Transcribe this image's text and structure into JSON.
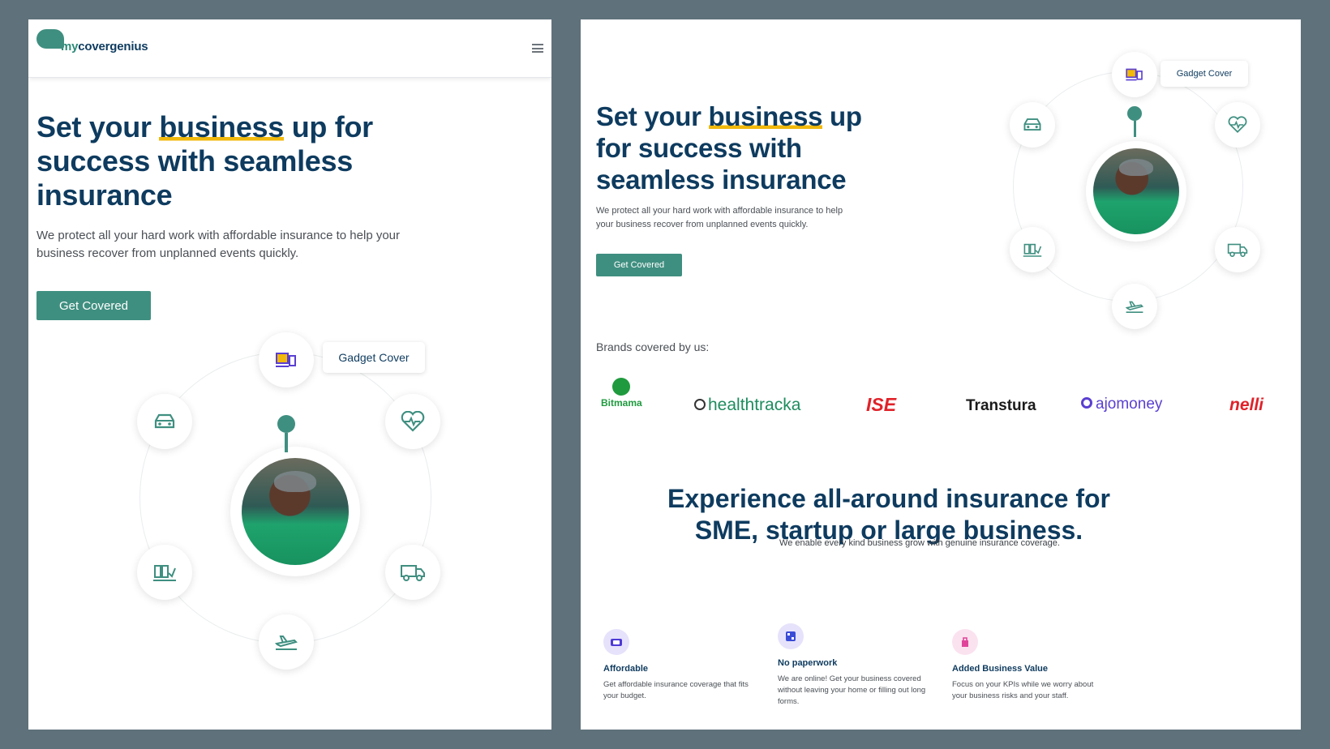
{
  "logo": {
    "prefix": "my",
    "name": "covergenius"
  },
  "hero": {
    "title_pre": "Set your ",
    "title_highlight": "business",
    "title_post": " up for success with seamless insurance",
    "description": "We protect all your hard work with affordable insurance to help your business recover from unplanned events quickly.",
    "cta_label": "Get Covered"
  },
  "orbit": {
    "tooltip": "Gadget Cover",
    "icons": [
      "gadget-icon",
      "car-icon",
      "heart-icon",
      "inventory-icon",
      "truck-icon",
      "plane-icon"
    ]
  },
  "brands": {
    "label": "Brands covered by us:",
    "items": [
      "Bitmama",
      "healthtracka",
      "ISE",
      "Transtura",
      "ajomoney",
      "nelli"
    ]
  },
  "section": {
    "title": "Experience all-around insurance for SME, startup or large business.",
    "subtitle": "We enable every kind business grow with genuine insurance coverage."
  },
  "features": [
    {
      "title": "Affordable",
      "desc": "Get affordable insurance coverage that fits your budget."
    },
    {
      "title": "No paperwork",
      "desc": "We are online! Get your business covered without leaving your home or filling out long forms."
    },
    {
      "title": "Added Business Value",
      "desc": "Focus on your KPIs while we worry about your business risks and your staff."
    }
  ],
  "colors": {
    "primary": "#3f8f80",
    "navy": "#0e3b5f",
    "highlight": "#f1b90b",
    "backdrop": "#5f717b"
  }
}
